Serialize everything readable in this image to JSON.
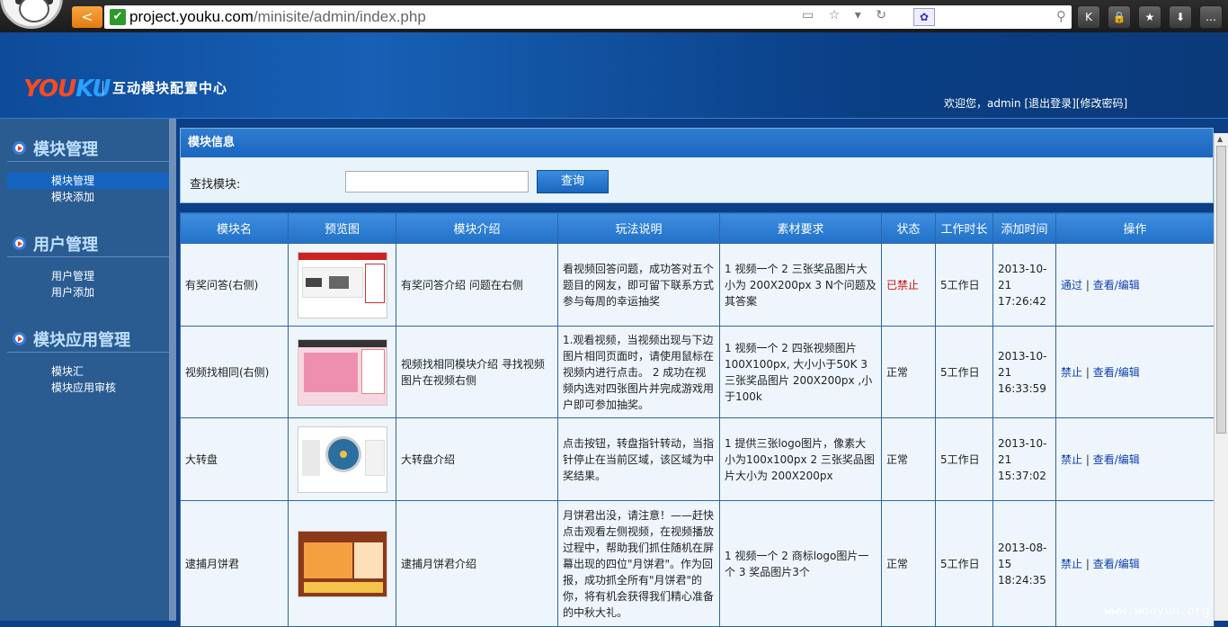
{
  "browser": {
    "url_domain": "project.youku.com",
    "url_path": "/minisite/admin/index.php",
    "back_glyph": "<",
    "toolbar_buttons": [
      "K",
      "🔒",
      "★",
      "⬇",
      "…"
    ]
  },
  "header": {
    "logo_you": "YOU",
    "logo_ku": "KU",
    "system_name": "互动模块配置中心",
    "welcome_prefix": "欢迎您，admin",
    "logout": "[退出登录]",
    "change_password": "[修改密码]"
  },
  "sidebar": {
    "groups": [
      {
        "title": "模块管理",
        "items": [
          "模块管理",
          "模块添加"
        ]
      },
      {
        "title": "用户管理",
        "items": [
          "用户管理",
          "用户添加"
        ]
      },
      {
        "title": "模块应用管理",
        "items": [
          "模块汇",
          "模块应用审核"
        ]
      }
    ]
  },
  "panel": {
    "title": "模块信息",
    "search_label": "查找模块:",
    "search_value": "",
    "search_button": "查询"
  },
  "table": {
    "headers": [
      "模块名",
      "预览图",
      "模块介绍",
      "玩法说明",
      "素材要求",
      "状态",
      "工作时长",
      "添加时间",
      "操作"
    ],
    "rows": [
      {
        "name": "有奖问答(右侧)",
        "intro": "有奖问答介绍 问题在右侧",
        "play": "看视频回答问题，成功答对五个题目的网友，即可留下联系方式参与每周的幸运抽奖",
        "material": "1 视频一个 2 三张奖品图片大小为 200X200px 3 N个问题及其答案",
        "status": "已禁止",
        "duration": "5工作日",
        "added": "2013-10-21 17:26:42",
        "action": "通过",
        "view": "查看/编辑"
      },
      {
        "name": "视频找相同(右侧)",
        "intro": "视频找相同模块介绍 寻找视频图片在视频右侧",
        "play": "1.观看视频，当视频出现与下边图片相同页面时，请使用鼠标在视频内进行点击。 2 成功在视频内选对四张图片并完成游戏用户即可参加抽奖。",
        "material": "1 视频一个 2 四张视频图片100X100px, 大小小于50K 3 三张奖品图片 200X200px ,小于100k",
        "status": "正常",
        "duration": "5工作日",
        "added": "2013-10-21 16:33:59",
        "action": "禁止",
        "view": "查看/编辑"
      },
      {
        "name": "大转盘",
        "intro": "大转盘介绍",
        "play": "点击按钮，转盘指针转动，当指针停止在当前区域，该区域为中奖结果。",
        "material": "1 提供三张logo图片，像素大小为100x100px 2 三张奖品图片大小为 200X200px",
        "status": "正常",
        "duration": "5工作日",
        "added": "2013-10-21 15:37:02",
        "action": "禁止",
        "view": "查看/编辑"
      },
      {
        "name": "逮捕月饼君",
        "intro": "逮捕月饼君介绍",
        "play": "月饼君出没，请注意！——赶快点击观看左侧视频，在视频播放过程中，帮助我们抓住随机在屏幕出现的四位\"月饼君\"。作为回报，成功抓全所有\"月饼君\"的你，将有机会获得我们精心准备的中秋大礼。",
        "material": "1 视频一个 2 商标logo图片一个 3 奖品图片3个",
        "status": "正常",
        "duration": "5工作日",
        "added": "2013-08-15 18:24:35",
        "action": "禁止",
        "view": "查看/编辑"
      }
    ]
  },
  "watermark": "www.wooyun.org"
}
